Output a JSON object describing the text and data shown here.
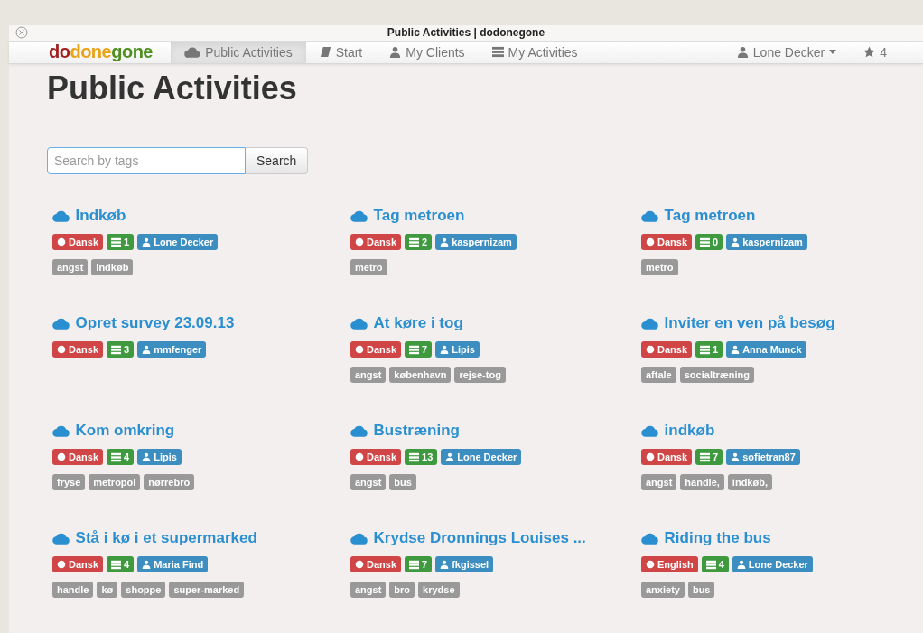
{
  "window": {
    "title": "Public Activities | dodonegone"
  },
  "navbar": {
    "brand": [
      {
        "text": "do",
        "color": "#a31f1f"
      },
      {
        "text": "done",
        "color": "#e8a317"
      },
      {
        "text": "gone",
        "color": "#4f8f1f"
      }
    ],
    "items": [
      {
        "label": "Public Activities",
        "selected": true
      },
      {
        "label": "Start",
        "selected": false
      },
      {
        "label": "My Clients",
        "selected": false
      },
      {
        "label": "My Activities",
        "selected": false
      }
    ],
    "user": {
      "label": "Lone Decker"
    },
    "stars": {
      "label": "4"
    }
  },
  "heading": "Public Activities",
  "search": {
    "placeholder": "Search by tags",
    "button": "Search"
  },
  "activities": [
    {
      "title": "Indkøb",
      "language": "Dansk",
      "count": "1",
      "owner": "Lone Decker",
      "tags": [
        "angst",
        "indkøb"
      ]
    },
    {
      "title": "Tag metroen",
      "language": "Dansk",
      "count": "2",
      "owner": "kaspernizam",
      "tags": [
        "metro"
      ]
    },
    {
      "title": "Tag metroen",
      "language": "Dansk",
      "count": "0",
      "owner": "kaspernizam",
      "tags": [
        "metro"
      ]
    },
    {
      "title": "Opret survey 23.09.13",
      "language": "Dansk",
      "count": "3",
      "owner": "mmfenger"
    },
    {
      "title": "At køre i tog",
      "language": "Dansk",
      "count": "7",
      "owner": "Lipis",
      "tags": [
        "angst",
        "københavn",
        "rejse-tog"
      ]
    },
    {
      "title": "Inviter en ven på besøg",
      "language": "Dansk",
      "count": "1",
      "owner": "Anna Munck",
      "tags": [
        "aftale",
        "socialtræning"
      ]
    },
    {
      "title": "Kom omkring",
      "language": "Dansk",
      "count": "4",
      "owner": "Lipis",
      "tags": [
        "fryse",
        "metropol",
        "nørrebro"
      ]
    },
    {
      "title": "Bustræning",
      "language": "Dansk",
      "count": "13",
      "owner": "Lone Decker",
      "tags": [
        "angst",
        "bus"
      ]
    },
    {
      "title": "indkøb",
      "language": "Dansk",
      "count": "7",
      "owner": "sofietran87",
      "tags": [
        "angst",
        "handle,",
        "indkøb,"
      ]
    },
    {
      "title": "Stå i kø i et supermarked",
      "language": "Dansk",
      "count": "4",
      "owner": "Maria Find",
      "tags": [
        "handle",
        "kø",
        "shoppe",
        "super-marked"
      ]
    },
    {
      "title": "Krydse Dronnings Louises ...",
      "language": "Dansk",
      "count": "7",
      "owner": "fkgissel",
      "tags": [
        "angst",
        "bro",
        "krydse"
      ]
    },
    {
      "title": "Riding the bus",
      "language": "English",
      "count": "4",
      "owner": "Lone Decker",
      "tags": [
        "anxiety",
        "bus"
      ]
    }
  ]
}
